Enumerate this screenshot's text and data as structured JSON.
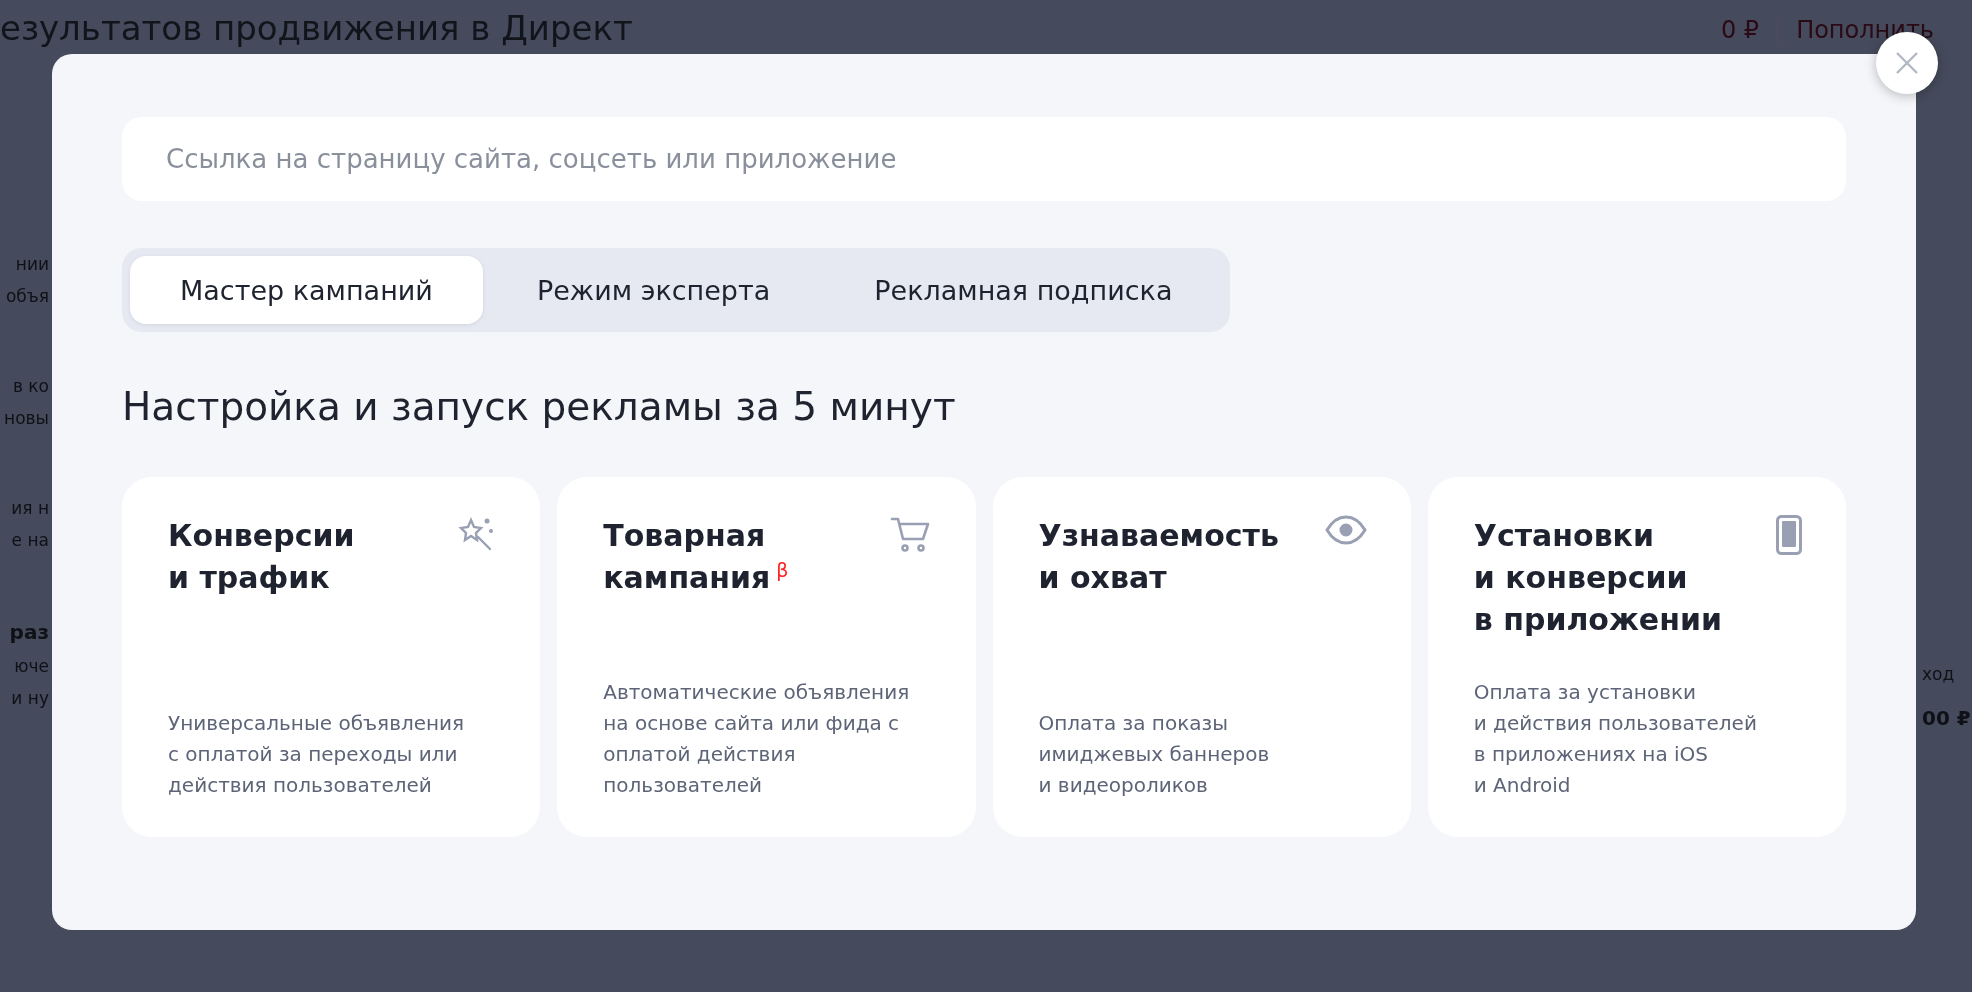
{
  "background": {
    "title": "езультатов продвижения в Директ",
    "balance": "0 ₽",
    "top_up": "Пополнить",
    "left_fragments": [
      [
        {
          "text": "нии",
          "kind": "text"
        },
        {
          "text": "объя",
          "kind": "text"
        }
      ],
      [
        {
          "text": "в ко",
          "kind": "text"
        },
        {
          "text": "новы",
          "kind": "text"
        }
      ],
      [
        {
          "text": "ия н",
          "kind": "text"
        },
        {
          "text": "е на",
          "kind": "text"
        }
      ],
      [
        {
          "text": "раз",
          "kind": "bold"
        },
        {
          "text": "юче",
          "kind": "text"
        },
        {
          "text": "и ну",
          "kind": "text"
        }
      ]
    ],
    "right_fragments": [
      {
        "text": "ход",
        "kind": "text"
      },
      {
        "text": "00 ₽",
        "kind": "bold"
      }
    ]
  },
  "modal": {
    "search": {
      "placeholder": "Ссылка на страницу сайта, соцсеть или приложение"
    },
    "tabs": [
      {
        "label": "Мастер кампаний",
        "selected": true
      },
      {
        "label": "Режим эксперта",
        "selected": false
      },
      {
        "label": "Рекламная подписка",
        "selected": false
      }
    ],
    "heading": "Настройка и запуск рекламы за 5 минут",
    "cards": [
      {
        "title": [
          "Конверсии",
          "и трафик"
        ],
        "description": [
          "Универсальные объявления",
          "с оплатой за переходы или",
          "действия пользователей"
        ]
      },
      {
        "title": [
          "Товарная",
          "кампания"
        ],
        "badge": "β",
        "description": [
          "Автоматические объявления",
          "на основе сайта или фида с",
          "оплатой действия",
          "пользователей"
        ]
      },
      {
        "title": [
          "Узнаваемость",
          "и охват"
        ],
        "description": [
          "Оплата за показы",
          "имиджевых баннеров",
          "и видеороликов"
        ]
      },
      {
        "title": [
          "Установки",
          "и конверсии",
          "в приложении"
        ],
        "description": [
          "Оплата за установки",
          "и действия пользователей",
          "в приложениях на iOS",
          "и Android"
        ]
      }
    ]
  }
}
